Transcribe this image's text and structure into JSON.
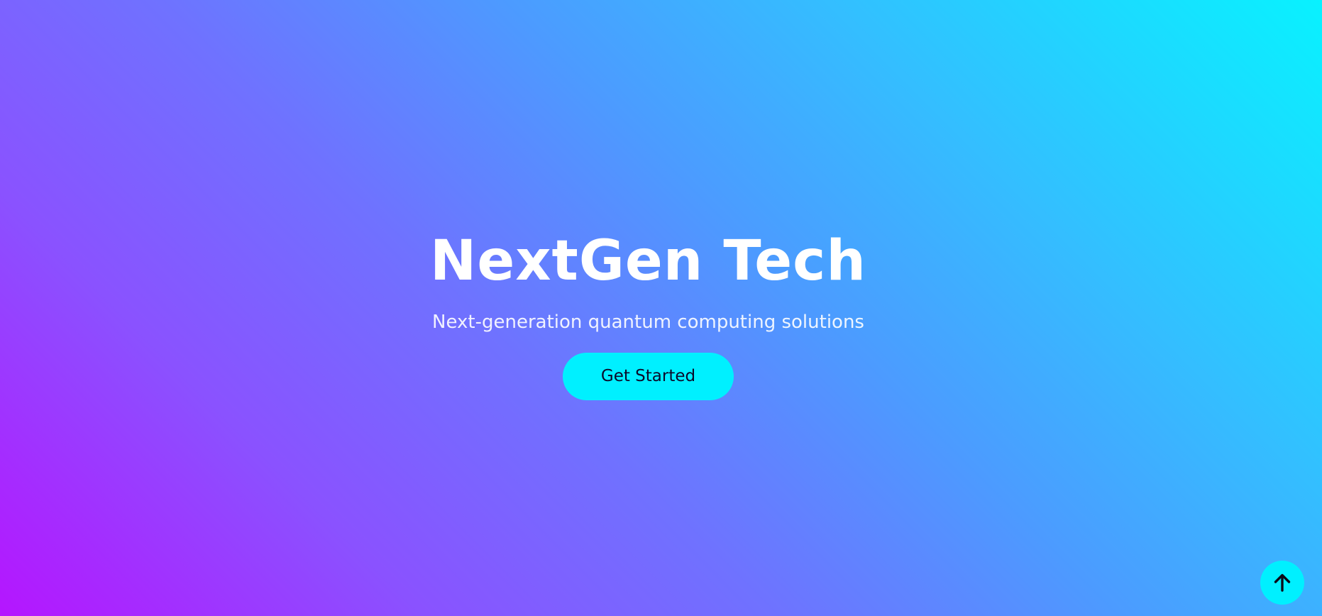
{
  "hero": {
    "title": "NextGen Tech",
    "subtitle": "Next-generation quantum computing solutions",
    "cta_label": "Get Started"
  },
  "scroll_top": {
    "icon": "arrow-up-icon"
  },
  "colors": {
    "gradient_start": "#b515ff",
    "gradient_end": "#08f2ff",
    "accent": "#00f0ff",
    "title_text": "#ffffff",
    "button_text": "#0b0b2a"
  }
}
